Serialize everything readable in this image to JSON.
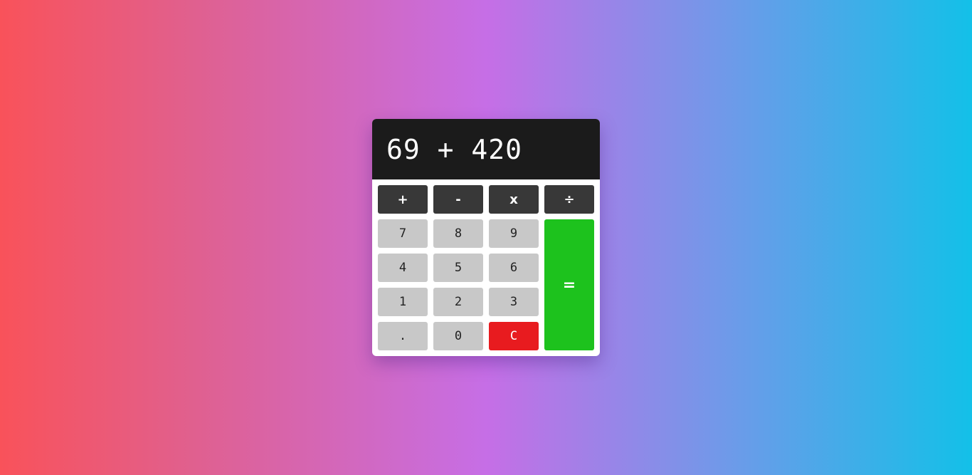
{
  "display": {
    "expression": "69 + 420"
  },
  "operators": {
    "add": "+",
    "subtract": "-",
    "multiply": "x",
    "divide": "÷"
  },
  "digits": {
    "seven": "7",
    "eight": "8",
    "nine": "9",
    "four": "4",
    "five": "5",
    "six": "6",
    "one": "1",
    "two": "2",
    "three": "3",
    "decimal": ".",
    "zero": "0"
  },
  "actions": {
    "clear": "C",
    "equals": "="
  },
  "colors": {
    "display_bg": "#1b1b1b",
    "operator_bg": "#383838",
    "number_bg": "#c8c8c8",
    "clear_bg": "#e81b1f",
    "equals_bg": "#1dc21d"
  }
}
